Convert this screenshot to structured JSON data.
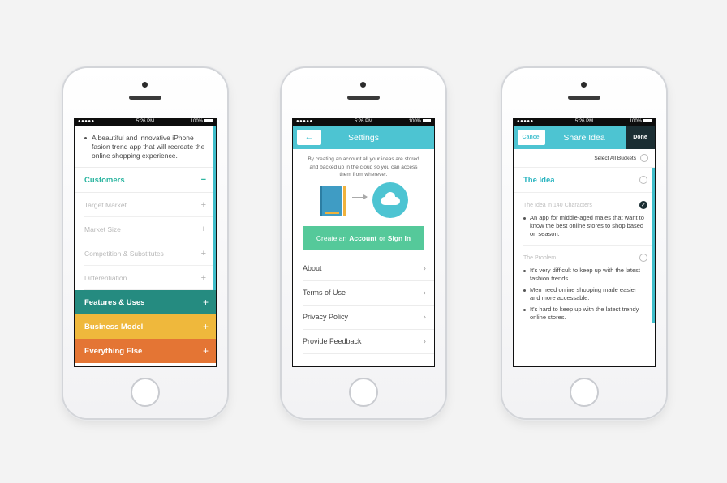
{
  "status_time": "5:26 PM",
  "status_battery": "100%",
  "screen1": {
    "intro": "A beautiful and innovative iPhone fasion trend app that will recreate the online shopping experience.",
    "section": {
      "label": "Customers",
      "sign": "−"
    },
    "subitems": [
      {
        "label": "Target Market",
        "sign": "+"
      },
      {
        "label": "Market Size",
        "sign": "+"
      },
      {
        "label": "Competition & Substitutes",
        "sign": "+"
      },
      {
        "label": "Differentiation",
        "sign": "+"
      }
    ],
    "bands": [
      {
        "label": "Features & Uses",
        "sign": "+"
      },
      {
        "label": "Business Model",
        "sign": "+"
      },
      {
        "label": "Everything Else",
        "sign": "+"
      }
    ]
  },
  "screen2": {
    "back_icon": "←",
    "title": "Settings",
    "copy": "By creating an account all your ideas are stored and backed up in the cloud so you can access them from wherever.",
    "create_pre": "Create an",
    "create_account": "Account",
    "create_or": "or",
    "create_signin": "Sign In",
    "menu": [
      "About",
      "Terms of Use",
      "Privacy Policy",
      "Provide Feedback"
    ],
    "chev": "›"
  },
  "screen3": {
    "cancel": "Cancel",
    "title": "Share Idea",
    "done": "Done",
    "select_all": "Select All Buckets",
    "idea_head": "The Idea",
    "field1_label": "The Idea in 140 Characters",
    "field1_check": "✓",
    "field1_bullets": [
      "An app for middle-aged males that want to know the best online stores to shop based on season."
    ],
    "field2_label": "The Problem",
    "field2_bullets": [
      "It's very difficult to keep up with the latest fashion trends.",
      "Men need online shopping made easier and more accessable.",
      "It's hard to keep up with the latest trendy online stores."
    ]
  }
}
